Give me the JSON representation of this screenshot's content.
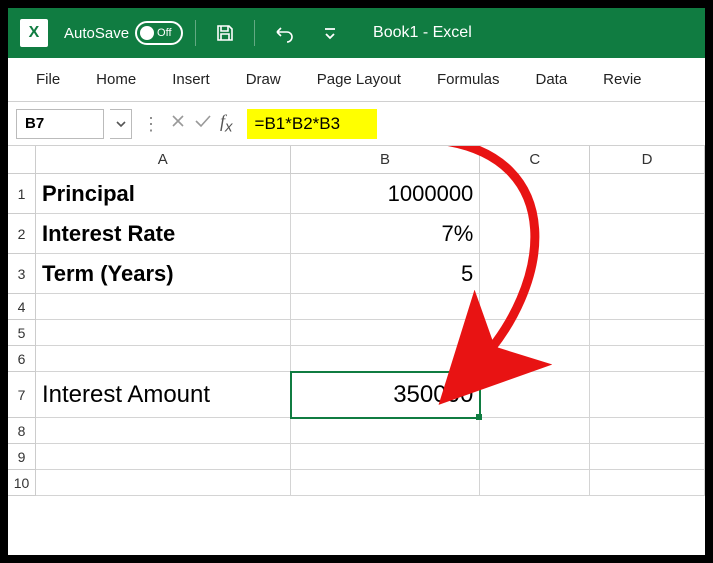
{
  "titlebar": {
    "autosave_label": "AutoSave",
    "autosave_state": "Off",
    "title": "Book1  -  Excel"
  },
  "ribbon": {
    "tabs": [
      "File",
      "Home",
      "Insert",
      "Draw",
      "Page Layout",
      "Formulas",
      "Data",
      "Revie"
    ]
  },
  "formula_bar": {
    "name_box": "B7",
    "formula": "=B1*B2*B3"
  },
  "columns": [
    "A",
    "B",
    "C",
    "D"
  ],
  "rows": [
    {
      "num": "1",
      "A": "Principal",
      "B": "1000000"
    },
    {
      "num": "2",
      "A": "Interest Rate",
      "B": "7%"
    },
    {
      "num": "3",
      "A": "Term (Years)",
      "B": "5"
    },
    {
      "num": "4",
      "A": "",
      "B": ""
    },
    {
      "num": "5",
      "A": "",
      "B": ""
    },
    {
      "num": "6",
      "A": "",
      "B": ""
    },
    {
      "num": "7",
      "A": "Interest Amount",
      "B": "350000"
    },
    {
      "num": "8",
      "A": "",
      "B": ""
    },
    {
      "num": "9",
      "A": "",
      "B": ""
    },
    {
      "num": "10",
      "A": "",
      "B": ""
    }
  ],
  "selected_cell": "B7"
}
